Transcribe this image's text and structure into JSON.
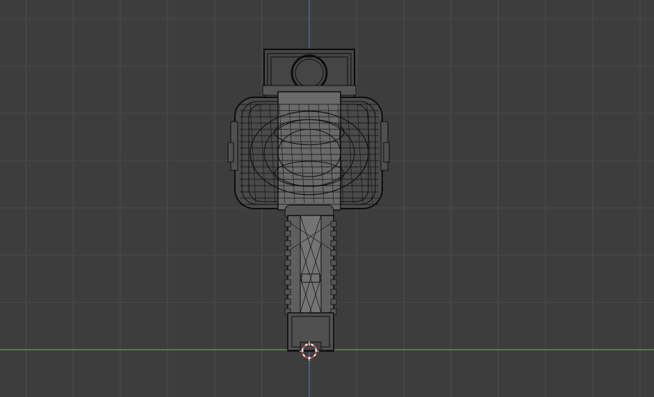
{
  "viewport": {
    "view": "wireframe-3d-viewport",
    "colors": {
      "background": "#3d3d3d",
      "grid_minor": "#474747",
      "grid_major": "#4d4d4d",
      "x_axis": "#5e8f45",
      "z_axis": "#4d6a91",
      "wire": "#0c0c0c",
      "wire_fill": "#5f5f5f",
      "cursor_red": "#d9473d",
      "cursor_white": "#ffffff"
    },
    "icons": {
      "model": "hammer-wireframe-model",
      "cursor": "3d-cursor-icon"
    }
  }
}
